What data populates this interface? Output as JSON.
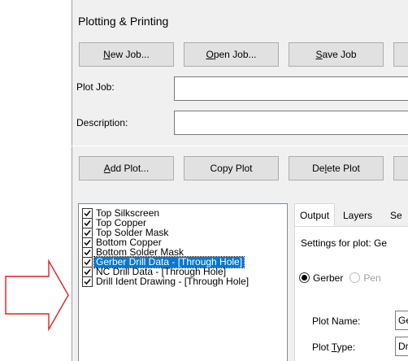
{
  "dialog": {
    "title": "Plotting & Printing"
  },
  "job_toolbar": {
    "new_job_prefix": "",
    "new_job_hotkey": "N",
    "new_job_suffix": "ew Job...",
    "open_job_prefix": "",
    "open_job_hotkey": "O",
    "open_job_suffix": "pen Job...",
    "save_job_prefix": "",
    "save_job_hotkey": "S",
    "save_job_suffix": "ave Job"
  },
  "fields": {
    "plot_job_label": "Plot Job:",
    "plot_job_value": "",
    "description_label": "Description:",
    "description_value": ""
  },
  "plot_toolbar": {
    "add_plot_prefix": "",
    "add_plot_hotkey": "A",
    "add_plot_suffix": "dd Plot...",
    "copy_plot": "Copy Plot",
    "delete_plot_prefix": "De",
    "delete_plot_hotkey": "l",
    "delete_plot_suffix": "ete Plot"
  },
  "plots": [
    {
      "label": "Top Silkscreen",
      "checked": true,
      "selected": false
    },
    {
      "label": "Top Copper",
      "checked": true,
      "selected": false
    },
    {
      "label": "Top Solder Mask",
      "checked": true,
      "selected": false
    },
    {
      "label": "Bottom Copper",
      "checked": true,
      "selected": false
    },
    {
      "label": "Bottom Solder Mask",
      "checked": true,
      "selected": false
    },
    {
      "label": "Gerber Drill Data - [Through Hole]",
      "checked": true,
      "selected": true
    },
    {
      "label": "NC Drill Data - [Through Hole]",
      "checked": true,
      "selected": false
    },
    {
      "label": "Drill Ident Drawing - [Through Hole]",
      "checked": true,
      "selected": false
    }
  ],
  "tabs": [
    "Output",
    "Layers",
    "Se"
  ],
  "active_tab": "Output",
  "output_panel": {
    "settings_label": "Settings for plot: Ge",
    "format_options": [
      {
        "label": "Gerber",
        "checked": true,
        "enabled": true
      },
      {
        "label": "Pen",
        "checked": false,
        "enabled": false
      }
    ],
    "plot_name_label": "Plot Name:",
    "plot_name_value": "Ge",
    "plot_type_label_prefix": "Plot ",
    "plot_type_label_hotkey": "T",
    "plot_type_label_suffix": "ype:",
    "plot_type_value": "Dr"
  },
  "colors": {
    "arrow_stroke": "#e02020",
    "selection": "#0078d7",
    "dialog_bg": "#f0f0f0"
  }
}
